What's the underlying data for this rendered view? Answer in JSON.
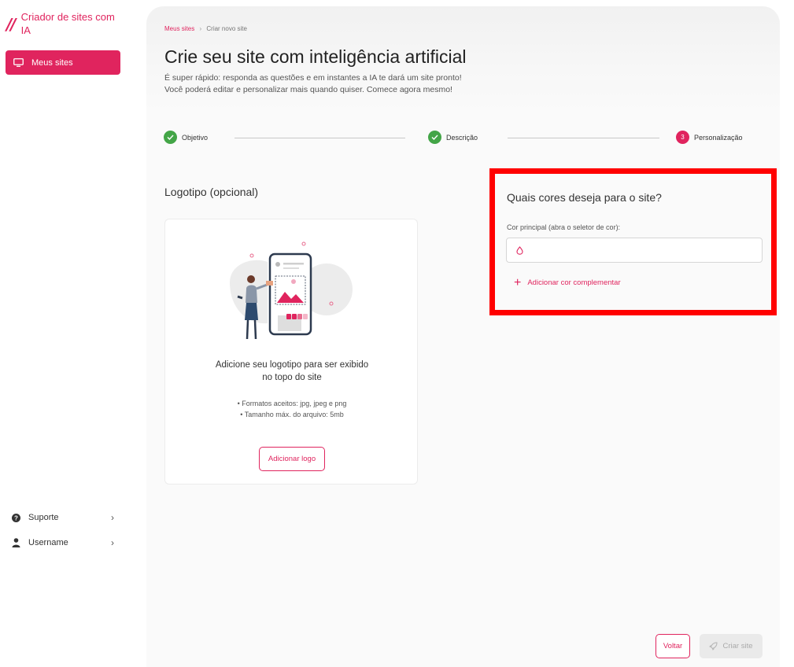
{
  "colors": {
    "accent": "#e0245e",
    "success": "#43a547",
    "highlight": "#ff0000"
  },
  "sidebar": {
    "brand_mark": "//",
    "brand_title": "Criador de sites com IA",
    "nav_active": {
      "label": "Meus sites",
      "icon": "monitor-icon"
    },
    "bottom": [
      {
        "label": "Suporte",
        "icon": "help-circle-icon"
      },
      {
        "label": "Username",
        "icon": "user-icon"
      }
    ]
  },
  "breadcrumb": {
    "link": "Meus sites",
    "separator": "›",
    "current": "Criar novo site"
  },
  "header": {
    "title": "Crie seu site com inteligência artificial",
    "subtitle_1": "É super rápido: responda as questões e em instantes a IA te dará um site pronto!",
    "subtitle_2": "Você poderá editar e personalizar mais quando quiser. Comece agora mesmo!"
  },
  "stepper": {
    "steps": [
      {
        "label": "Objetivo",
        "status": "done"
      },
      {
        "label": "Descrição",
        "status": "done"
      },
      {
        "label": "Personalização",
        "status": "active",
        "number": "3"
      }
    ]
  },
  "logo_section": {
    "title": "Logotipo (opcional)",
    "card_title_1": "Adicione seu logotipo para ser exibido",
    "card_title_2": "no topo do site",
    "bullet_1": "• Formatos aceitos: jpg, jpeg e png",
    "bullet_2": "• Tamanho máx. do arquivo: 5mb",
    "button": "Adicionar logo"
  },
  "colors_section": {
    "title": "Quais cores deseja para o site?",
    "field_label": "Cor principal (abra o seletor de cor):",
    "field_value": "",
    "add_label": "Adicionar cor complementar"
  },
  "footer": {
    "back": "Voltar",
    "create": "Criar site"
  }
}
